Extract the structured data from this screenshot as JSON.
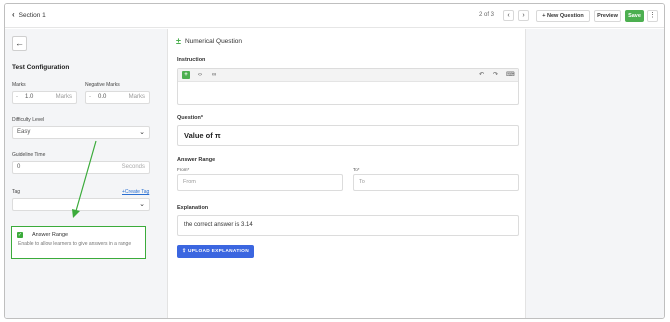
{
  "topbar": {
    "section_label": "Section 1",
    "pager": "2 of 3",
    "prev_icon": "chevron-left-icon",
    "next_icon": "chevron-right-icon",
    "new_question_label": "New Question",
    "preview_label": "Preview",
    "save_label": "Save",
    "save_color": "#4caf50"
  },
  "sidebar": {
    "title": "Test Configuration",
    "marks": {
      "label": "Marks",
      "prefix": "-",
      "value": "1.0",
      "suffix": "Marks"
    },
    "negative_marks": {
      "label": "Negative Marks",
      "prefix": "-",
      "value": "0.0",
      "suffix": "Marks"
    },
    "difficulty": {
      "label": "Difficulty Level",
      "value": "Easy"
    },
    "guideline": {
      "label": "Guideline Time",
      "value": "0",
      "suffix": "Seconds"
    },
    "tag": {
      "label": "Tag",
      "create_link": "+Create Tag",
      "value": ""
    },
    "answer_range": {
      "title": "Answer Range",
      "checked": true,
      "description": "Enable to allow learners to give answers in a range",
      "highlight_color": "#3bab3b"
    }
  },
  "main": {
    "question_type": "Numerical Question",
    "instruction_label": "Instruction",
    "question_label": "Question*",
    "question_value": "Value of π",
    "answer_range_label": "Answer Range",
    "from_label": "From*",
    "from_placeholder": "From",
    "to_label": "To*",
    "to_placeholder": "To",
    "explanation_label": "Explanation",
    "explanation_value": "the correct answer is 3.14",
    "upload_label": "UPLOAD EXPLANATION",
    "upload_color": "#3b66e0"
  }
}
